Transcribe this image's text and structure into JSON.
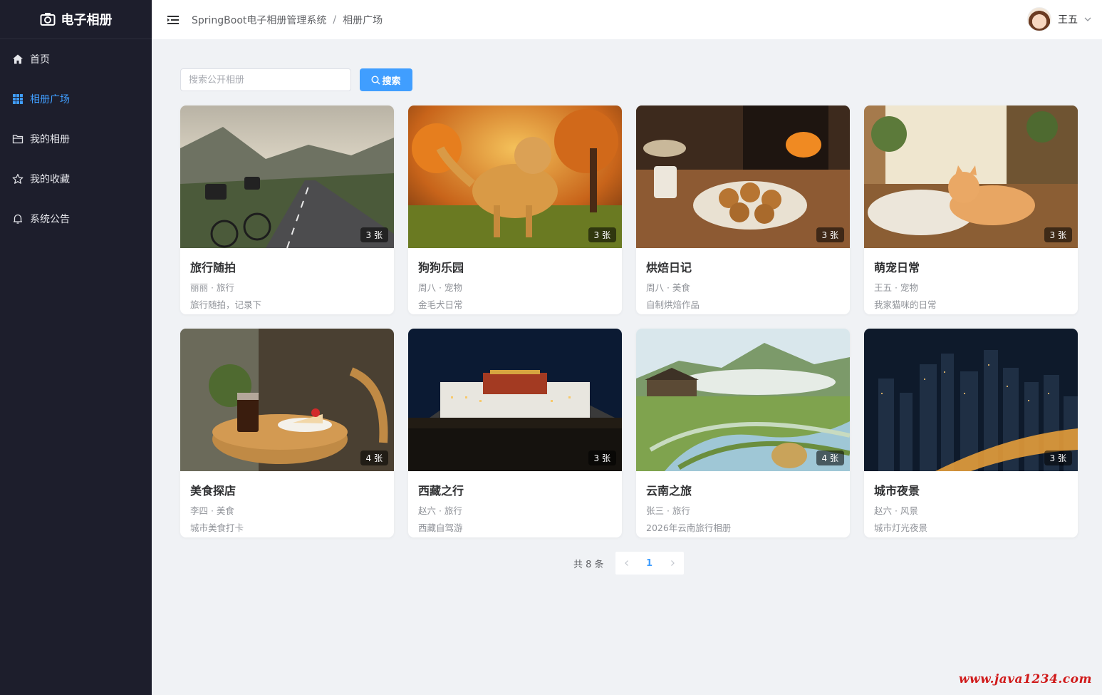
{
  "app": {
    "logo_text": "电子相册"
  },
  "sidebar": {
    "items": [
      {
        "label": "首页",
        "icon": "home-icon",
        "active": false
      },
      {
        "label": "相册广场",
        "icon": "grid-icon",
        "active": true
      },
      {
        "label": "我的相册",
        "icon": "folder-icon",
        "active": false
      },
      {
        "label": "我的收藏",
        "icon": "star-icon",
        "active": false
      },
      {
        "label": "系统公告",
        "icon": "bell-icon",
        "active": false
      }
    ]
  },
  "header": {
    "breadcrumb": [
      "SpringBoot电子相册管理系统",
      "相册广场"
    ],
    "breadcrumb_sep": "/",
    "user_name": "王五"
  },
  "search": {
    "placeholder": "搜索公开相册",
    "button_label": "搜索"
  },
  "albums": [
    {
      "title": "旅行随拍",
      "meta": "丽丽 · 旅行",
      "desc": "旅行随拍，记录下",
      "count": "3 张"
    },
    {
      "title": "狗狗乐园",
      "meta": "周八 · 宠物",
      "desc": "金毛犬日常",
      "count": "3 张"
    },
    {
      "title": "烘焙日记",
      "meta": "周八 · 美食",
      "desc": "自制烘焙作品",
      "count": "3 张"
    },
    {
      "title": "萌宠日常",
      "meta": "王五 · 宠物",
      "desc": "我家猫咪的日常",
      "count": "3 张"
    },
    {
      "title": "美食探店",
      "meta": "李四 · 美食",
      "desc": "城市美食打卡",
      "count": "4 张"
    },
    {
      "title": "西藏之行",
      "meta": "赵六 · 旅行",
      "desc": "西藏自驾游",
      "count": "3 张"
    },
    {
      "title": "云南之旅",
      "meta": "张三 · 旅行",
      "desc": "2026年云南旅行相册",
      "count": "4 张"
    },
    {
      "title": "城市夜景",
      "meta": "赵六 · 风景",
      "desc": "城市灯光夜景",
      "count": "3 张"
    }
  ],
  "pagination": {
    "total_text": "共 8 条",
    "current_page": "1"
  },
  "watermark": "www.java1234.com",
  "colors": {
    "accent": "#409eff",
    "sidebar_bg": "#1d1e2c",
    "watermark": "#d01a1a"
  }
}
